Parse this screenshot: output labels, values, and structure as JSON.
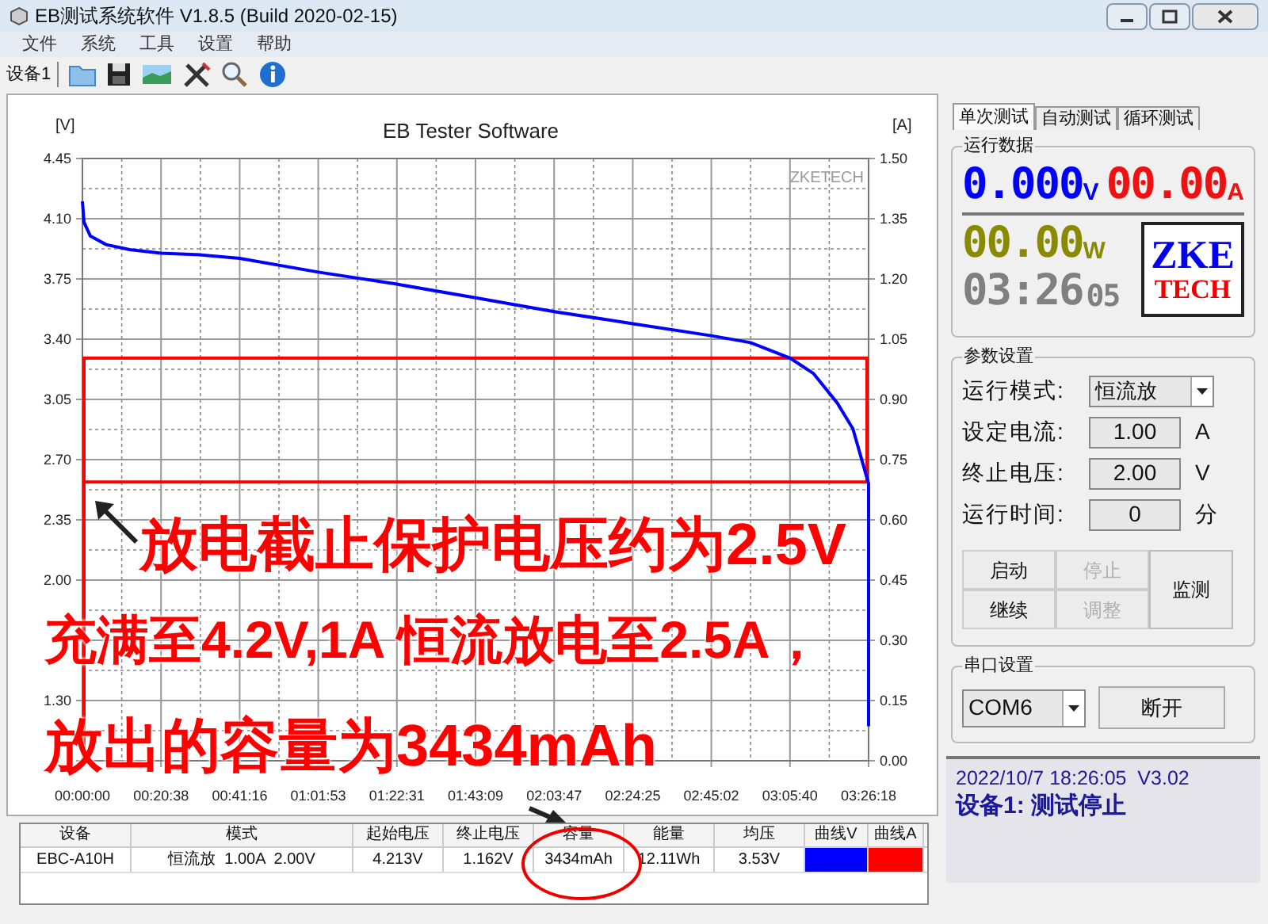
{
  "window": {
    "title": "EB测试系统软件 V1.8.5 (Build 2020-02-15)"
  },
  "menu": [
    "文件",
    "系统",
    "工具",
    "设置",
    "帮助"
  ],
  "toolbar": {
    "device": "设备1"
  },
  "chart": {
    "brand": "ZKETECH",
    "chart_data": {
      "type": "line",
      "title": "EB Tester Software",
      "ylabel": "[V]",
      "y2label": "[A]",
      "grid": true,
      "x": [
        0,
        25,
        124,
        371,
        743,
        1238,
        1857,
        2476,
        3713,
        4951,
        6189,
        7427,
        8665,
        9902,
        10521,
        11140,
        11512,
        11883,
        12130,
        12378,
        12378
      ],
      "series": [
        {
          "color": "#0000ff",
          "values": [
            4.2,
            4.08,
            4.0,
            3.95,
            3.92,
            3.9,
            3.89,
            3.87,
            3.79,
            3.72,
            3.64,
            3.56,
            3.49,
            3.42,
            3.38,
            3.29,
            3.2,
            3.03,
            2.88,
            2.56,
            1.15
          ]
        }
      ],
      "xlim": [
        0,
        12378
      ],
      "ylim": [
        0.95,
        4.45
      ],
      "xticks": [
        {
          "value": 0,
          "label": "00:00:00"
        },
        {
          "value": 1238,
          "label": "00:20:38"
        },
        {
          "value": 2476,
          "label": "00:41:16"
        },
        {
          "value": 3713,
          "label": "01:01:53"
        },
        {
          "value": 4951,
          "label": "01:22:31"
        },
        {
          "value": 6189,
          "label": "01:43:09"
        },
        {
          "value": 7427,
          "label": "02:03:47"
        },
        {
          "value": 8665,
          "label": "02:24:25"
        },
        {
          "value": 9902,
          "label": "02:45:02"
        },
        {
          "value": 11140,
          "label": "03:05:40"
        },
        {
          "value": 12378,
          "label": "03:26:18"
        }
      ],
      "yticks": [
        {
          "value": 4.45,
          "label": "4.45"
        },
        {
          "value": 4.1,
          "label": "4.10"
        },
        {
          "value": 3.75,
          "label": "3.75"
        },
        {
          "value": 3.4,
          "label": "3.40"
        },
        {
          "value": 3.05,
          "label": "3.05"
        },
        {
          "value": 2.7,
          "label": "2.70"
        },
        {
          "value": 2.35,
          "label": "2.35"
        },
        {
          "value": 2.0,
          "label": "2.00"
        },
        {
          "value": 1.3,
          "label": "1.30"
        }
      ],
      "y2ticks": [
        "1.50",
        "1.35",
        "1.20",
        "1.05",
        "0.90",
        "0.75",
        "0.60",
        "0.45",
        "0.30",
        "0.15",
        "0.00"
      ]
    }
  },
  "notes": [
    "放电截止保护电压约为2.5V",
    "充满至4.2V,1A 恒流放电至2.5A，",
    "放出的容量为3434mAh"
  ],
  "table": {
    "columns": [
      "设备",
      "模式",
      "起始电压",
      "终止电压",
      "容量",
      "能量",
      "均压",
      "曲线V",
      "曲线A"
    ],
    "rows": [
      {
        "cells": [
          {
            "kind": "text",
            "text": "EBC-A10H"
          },
          {
            "kind": "text",
            "text": "恒流放  1.00A  2.00V"
          },
          {
            "kind": "text",
            "text": "4.213V"
          },
          {
            "kind": "text",
            "text": "1.162V"
          },
          {
            "kind": "text",
            "text": "3434mAh"
          },
          {
            "kind": "text",
            "text": "12.11Wh"
          },
          {
            "kind": "text",
            "text": "3.53V"
          },
          {
            "kind": "swatch",
            "color": "#0000ff"
          },
          {
            "kind": "swatch",
            "color": "#ff0000"
          }
        ]
      }
    ]
  },
  "tabs": [
    {
      "label": "单次测试",
      "selected": true
    },
    {
      "label": "自动测试",
      "selected": false
    },
    {
      "label": "循环测试",
      "selected": false
    }
  ],
  "run_data": {
    "title": "运行数据",
    "voltage": "0.000",
    "voltage_unit": "V",
    "current": "00.00",
    "current_unit": "A",
    "power": "00.00",
    "power_unit": "W",
    "time": "03:26",
    "time_sec": "05",
    "logo_top": "ZKE",
    "logo_bottom": "TECH"
  },
  "params": {
    "title": "参数设置",
    "rows": [
      {
        "kind": "select",
        "label": "运行模式:",
        "value": "恒流放"
      },
      {
        "kind": "field",
        "label": "设定电流:",
        "value": "1.00",
        "unit": "A"
      },
      {
        "kind": "field",
        "label": "终止电压:",
        "value": "2.00",
        "unit": "V"
      },
      {
        "kind": "field",
        "label": "运行时间:",
        "value": "0",
        "unit": "分"
      }
    ],
    "buttons": [
      {
        "label": "启动",
        "disabled": false
      },
      {
        "label": "停止",
        "disabled": true
      },
      {
        "label": "继续",
        "disabled": false
      },
      {
        "label": "调整",
        "disabled": true
      }
    ],
    "monitor": "监测"
  },
  "serial": {
    "title": "串口设置",
    "port": "COM6",
    "button": "断开"
  },
  "status": {
    "line1": "2022/10/7 18:26:05  V3.02",
    "line2": "设备1: 测试停止"
  }
}
